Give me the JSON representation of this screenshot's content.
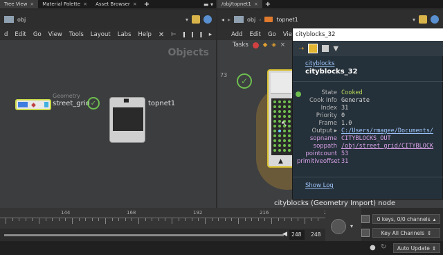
{
  "left_tabs": [
    {
      "label": "Tree View"
    },
    {
      "label": "Material Palette"
    },
    {
      "label": "Asset Browser"
    }
  ],
  "right_tabs": [
    {
      "label": "/obj/topnet1"
    }
  ],
  "left_path": "obj",
  "right_path": {
    "root": "obj",
    "child": "topnet1"
  },
  "left_menu": [
    "d",
    "Edit",
    "Go",
    "View",
    "Tools",
    "Layout",
    "Labs",
    "Help"
  ],
  "right_menu": [
    "Add",
    "Edit",
    "Go",
    "Viev"
  ],
  "right_toolbar": {
    "tasks_label": "Tasks"
  },
  "network_left": {
    "watermark": "Objects",
    "node_geo": {
      "type_label": "Geometry",
      "name": "street_grid"
    },
    "node_top": {
      "name": "topnet1"
    }
  },
  "network_right": {
    "badge_number": "73",
    "node_caption": "cityblocks (Geometry Import) node"
  },
  "popup": {
    "title": "cityblocks_32",
    "parent_link": "cityblocks",
    "heading": "cityblocks_32",
    "rows": [
      {
        "key": "State",
        "value": "Cooked"
      },
      {
        "key": "Cook Info",
        "value": "Generate"
      },
      {
        "key": "Index",
        "value": "31"
      },
      {
        "key": "Priority",
        "value": "0"
      },
      {
        "key": "Frame",
        "value": "1.0"
      },
      {
        "key": "Output",
        "value": "C:/Users/rmagee/Documents/"
      },
      {
        "key": "sopname",
        "value": "CITYBLOCKS_OUT"
      },
      {
        "key": "soppath",
        "value": "/obj/street_grid/CITYBLOCK"
      },
      {
        "key": "pointcount",
        "value": "53"
      },
      {
        "key": "primitiveoffset",
        "value": "31"
      }
    ],
    "show_log": "Show Log"
  },
  "timeline": {
    "ticks": [
      "144",
      "168",
      "192",
      "216",
      "2"
    ],
    "frame_current": "248",
    "frame_end": "248",
    "keys_label": "0 keys, 0/0 channels",
    "key_all_label": "Key All Channels",
    "auto_update_label": "Auto Update"
  },
  "colors": {
    "accent_green": "#6fbf4f",
    "state_cooked": "#b9d85a",
    "link_blue": "#7db7ff",
    "popup_bg": "#25313a"
  }
}
